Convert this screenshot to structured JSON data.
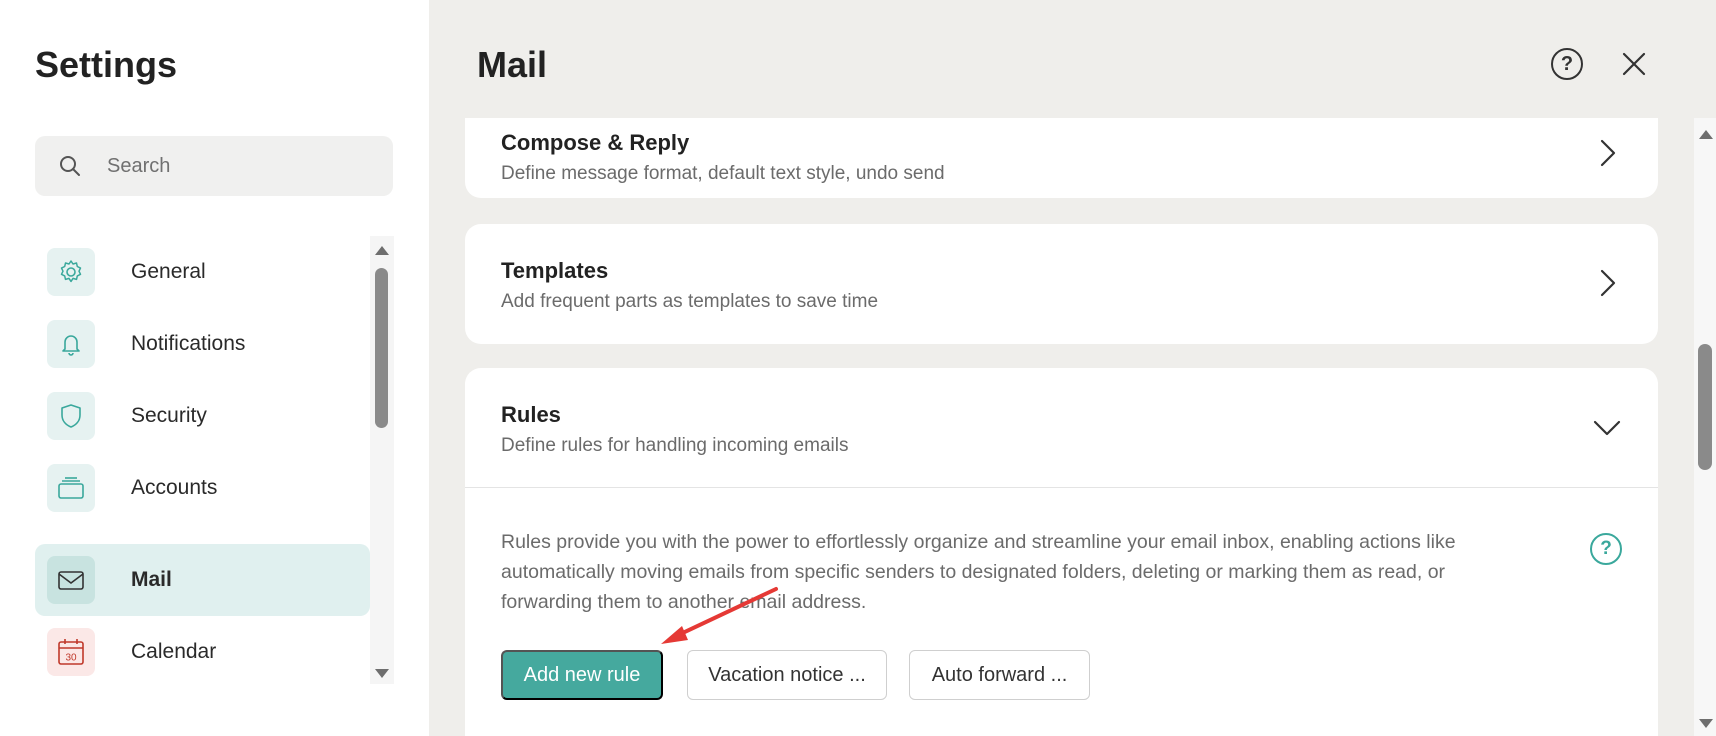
{
  "settings": {
    "title": "Settings",
    "search_placeholder": "Search",
    "nav": [
      {
        "label": "General",
        "icon": "gear-icon"
      },
      {
        "label": "Notifications",
        "icon": "bell-icon"
      },
      {
        "label": "Security",
        "icon": "shield-icon"
      },
      {
        "label": "Accounts",
        "icon": "accounts-icon"
      },
      {
        "label": "Mail",
        "icon": "mail-icon",
        "active": true
      },
      {
        "label": "Calendar",
        "icon": "calendar-icon",
        "day": "30"
      }
    ]
  },
  "main": {
    "title": "Mail",
    "sections": [
      {
        "title": "Compose & Reply",
        "subtitle": "Define message format, default text style, undo send"
      },
      {
        "title": "Templates",
        "subtitle": "Add frequent parts as templates to save time"
      },
      {
        "title": "Rules",
        "subtitle": "Define rules for handling incoming emails",
        "description": "Rules provide you with the power to effortlessly organize and streamline your email inbox, enabling actions like automatically moving emails from specific senders to designated folders, deleting or marking them as read, or forwarding them to another email address.",
        "buttons": {
          "add_rule": "Add new rule",
          "vacation": "Vacation notice ...",
          "auto_forward": "Auto forward ..."
        }
      }
    ]
  },
  "colors": {
    "accent": "#45a99e",
    "annotation_arrow": "#e53935",
    "active_nav_bg": "#e0f0ef"
  }
}
